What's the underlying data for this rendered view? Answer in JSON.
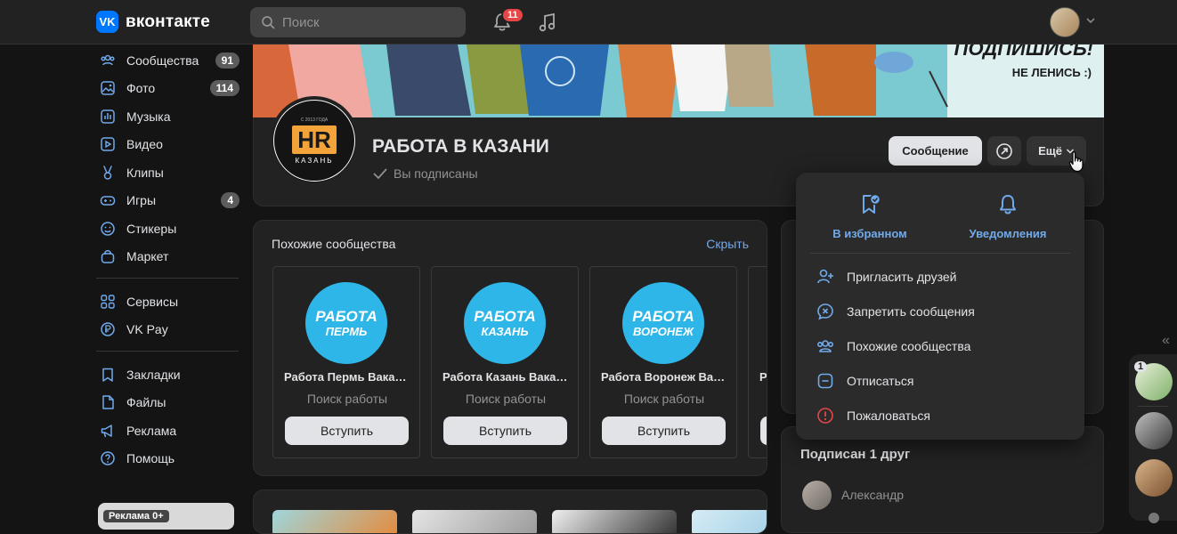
{
  "topbar": {
    "logo_badge": "VK",
    "logo_text": "вконтакте",
    "search_placeholder": "Поиск",
    "notifications_count": "11"
  },
  "sidebar": {
    "items": [
      {
        "label": "Сообщества",
        "count": "91",
        "icon": "communities-icon"
      },
      {
        "label": "Фото",
        "count": "114",
        "icon": "photo-icon"
      },
      {
        "label": "Музыка",
        "count": "",
        "icon": "music-icon"
      },
      {
        "label": "Видео",
        "count": "",
        "icon": "video-icon"
      },
      {
        "label": "Клипы",
        "count": "",
        "icon": "clips-icon"
      },
      {
        "label": "Игры",
        "count": "4",
        "icon": "games-icon"
      },
      {
        "label": "Стикеры",
        "count": "",
        "icon": "stickers-icon"
      },
      {
        "label": "Маркет",
        "count": "",
        "icon": "market-icon"
      },
      {
        "label": "Сервисы",
        "count": "",
        "icon": "services-icon"
      },
      {
        "label": "VK Pay",
        "count": "",
        "icon": "vkpay-icon"
      },
      {
        "label": "Закладки",
        "count": "",
        "icon": "bookmarks-icon"
      },
      {
        "label": "Файлы",
        "count": "",
        "icon": "files-icon"
      },
      {
        "label": "Реклама",
        "count": "",
        "icon": "ads-icon"
      },
      {
        "label": "Помощь",
        "count": "",
        "icon": "help-icon"
      }
    ],
    "ad_label": "Реклама 0+"
  },
  "cover": {
    "title": "ПОДПИШИСЬ!",
    "subtitle": "НЕ ЛЕНИСЬ :)"
  },
  "group": {
    "avatar_top": "С 2013 ГОДА",
    "avatar_main": "HR",
    "avatar_sub": "КАЗАНЬ",
    "title": "РАБОТА В КАЗАНИ",
    "subscribed": "Вы подписаны",
    "btn_message": "Сообщение",
    "btn_more": "Ещё"
  },
  "similar": {
    "title": "Похожие сообщества",
    "hide": "Скрыть",
    "items": [
      {
        "logo1": "РАБОТА",
        "logo2": "ПЕРМЬ",
        "name": "Работа Пермь Вакансии",
        "sub": "Поиск работы",
        "btn": "Вступить"
      },
      {
        "logo1": "РАБОТА",
        "logo2": "КАЗАНЬ",
        "name": "Работа Казань Вакансии",
        "sub": "Поиск работы",
        "btn": "Вступить"
      },
      {
        "logo1": "РАБОТА",
        "logo2": "ВОРОНЕЖ",
        "name": "Работа Воронеж Вакансии",
        "sub": "Поиск работы",
        "btn": "Вступить"
      },
      {
        "logo1": "",
        "logo2": "",
        "name": "Р",
        "sub": "",
        "btn": ""
      }
    ]
  },
  "dropdown": {
    "fav": "В избранном",
    "notif": "Уведомления",
    "items": [
      {
        "label": "Пригласить друзей",
        "icon": "invite-friends-icon",
        "color": "#71aaeb"
      },
      {
        "label": "Запретить сообщения",
        "icon": "block-messages-icon",
        "color": "#71aaeb"
      },
      {
        "label": "Похожие сообщества",
        "icon": "similar-communities-icon",
        "color": "#71aaeb"
      },
      {
        "label": "Отписаться",
        "icon": "unsubscribe-icon",
        "color": "#71aaeb"
      },
      {
        "label": "Пожаловаться",
        "icon": "report-icon",
        "color": "#e64646"
      }
    ]
  },
  "friends": {
    "title": "Подписан 1 друг",
    "name": "Александр"
  },
  "strip": {
    "badge": "1"
  },
  "colors": {
    "accent": "#71aaeb",
    "brand": "#0077ff",
    "danger": "#e64646"
  }
}
